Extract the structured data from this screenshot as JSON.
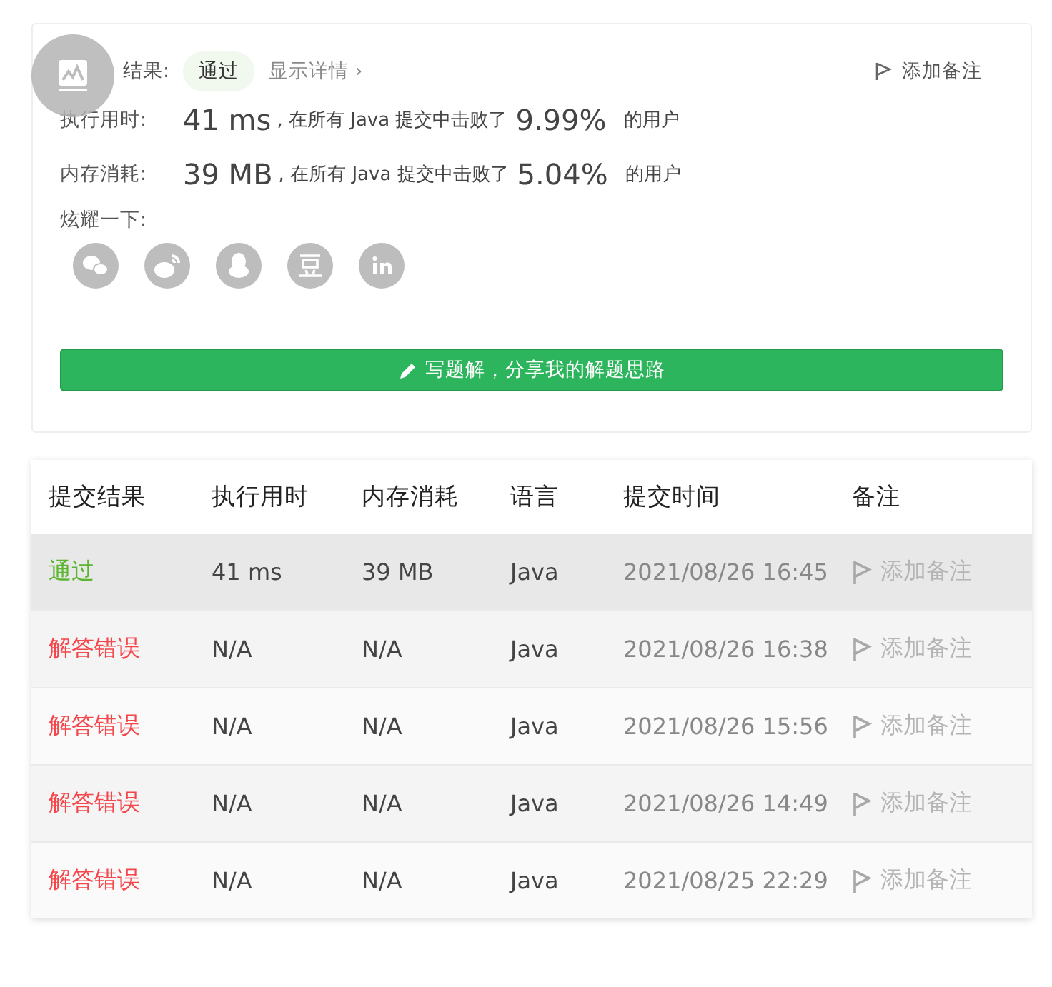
{
  "result": {
    "label": "结果:",
    "status": "通过",
    "details_link": "显示详情",
    "details_arrow": "›",
    "add_note": "添加备注"
  },
  "stats": [
    {
      "label": "执行用时:",
      "value": "41 ms",
      "mid": ", 在所有 Java 提交中击败了",
      "percent": "9.99%",
      "tail": "的用户"
    },
    {
      "label": "内存消耗:",
      "value": "39 MB",
      "mid": ", 在所有 Java 提交中击败了",
      "percent": "5.04%",
      "tail": "的用户"
    }
  ],
  "share": {
    "label": "炫耀一下:",
    "icons": [
      {
        "kind": "wechat"
      },
      {
        "kind": "weibo"
      },
      {
        "kind": "qq"
      },
      {
        "kind": "douban"
      },
      {
        "kind": "linkedin"
      }
    ]
  },
  "write_button": "写题解，分享我的解题思路",
  "table": {
    "columns": [
      "提交结果",
      "执行用时",
      "内存消耗",
      "语言",
      "提交时间",
      "备注"
    ],
    "rows": [
      {
        "selected": true,
        "status": "通过",
        "color": "#5cb531",
        "time": "41 ms",
        "memory": "39 MB",
        "language": "Java",
        "submitted": "2021/08/26 16:45",
        "note": "添加备注"
      },
      {
        "selected": false,
        "status": "解答错误",
        "color": "#f5464b",
        "time": "N/A",
        "memory": "N/A",
        "language": "Java",
        "submitted": "2021/08/26 16:38",
        "note": "添加备注"
      },
      {
        "selected": false,
        "status": "解答错误",
        "color": "#f5464b",
        "time": "N/A",
        "memory": "N/A",
        "language": "Java",
        "submitted": "2021/08/26 15:56",
        "note": "添加备注"
      },
      {
        "selected": false,
        "status": "解答错误",
        "color": "#f5464b",
        "time": "N/A",
        "memory": "N/A",
        "language": "Java",
        "submitted": "2021/08/26 14:49",
        "note": "添加备注"
      },
      {
        "selected": false,
        "status": "解答错误",
        "color": "#f5464b",
        "time": "N/A",
        "memory": "N/A",
        "language": "Java",
        "submitted": "2021/08/25 22:29",
        "note": "添加备注"
      }
    ]
  }
}
